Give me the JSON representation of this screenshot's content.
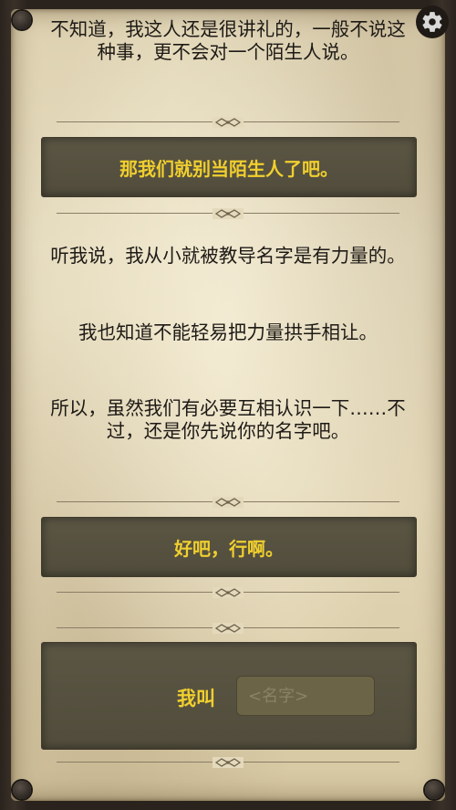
{
  "dialogue": {
    "intro_text": "不知道，我这人还是很讲礼的，一般不说这种事，更不会对一个陌生人说。",
    "choice_1": "那我们就别当陌生人了吧。",
    "para_1": "听我说，我从小就被教导名字是有力量的。",
    "para_2": "我也知道不能轻易把力量拱手相让。",
    "para_3": "所以，虽然我们有必要互相认识一下……不过，还是你先说你的名字吧。",
    "choice_2": "好吧，行啊。"
  },
  "name_entry": {
    "label": "我叫",
    "placeholder": "<名字>",
    "value": ""
  },
  "icons": {
    "settings": "gear-icon",
    "divider": "ornament-icon"
  },
  "colors": {
    "accent": "#f0cf2e",
    "panel": "#55503f",
    "parchment": "#e2d6b6"
  }
}
